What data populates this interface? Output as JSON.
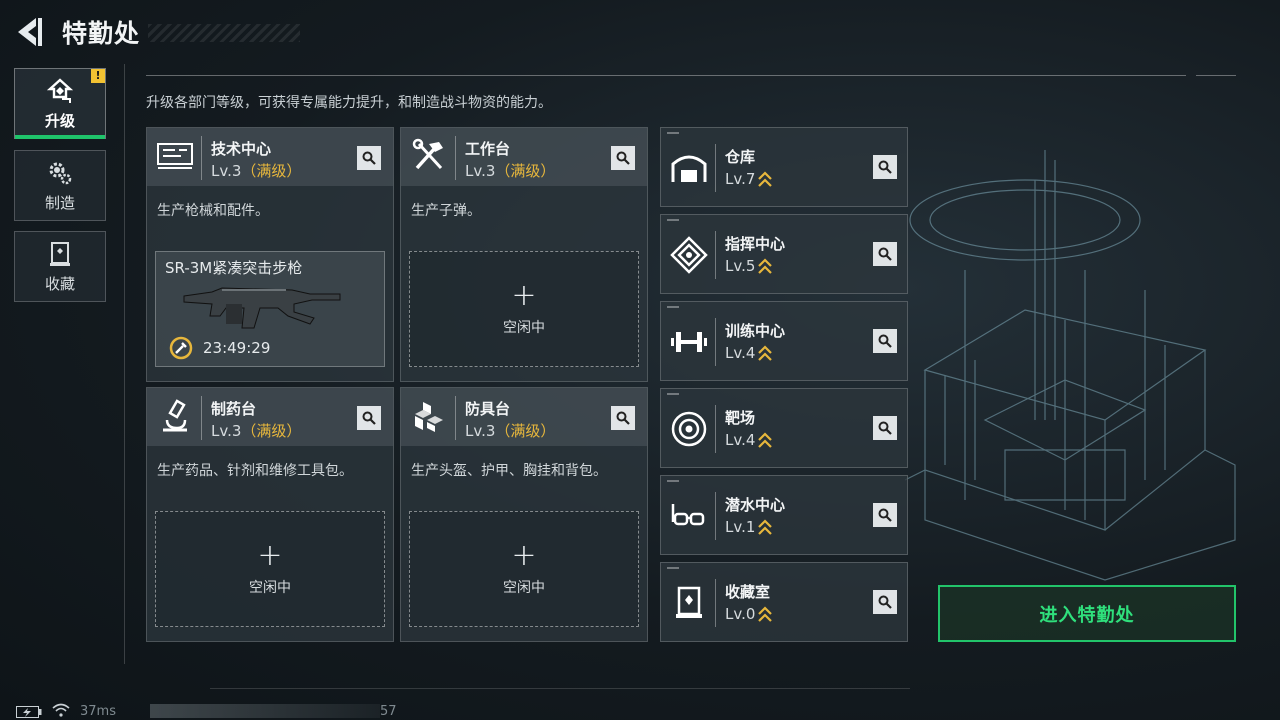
{
  "header": {
    "title": "特勤处"
  },
  "sidebar": {
    "tabs": [
      {
        "label": "升级",
        "active": true,
        "badge": "!"
      },
      {
        "label": "制造",
        "active": false
      },
      {
        "label": "收藏",
        "active": false
      }
    ]
  },
  "description": "升级各部门等级，可获得专属能力提升，和制造战斗物资的能力。",
  "departments": [
    {
      "name": "技术中心",
      "level": "Lv.3",
      "max_label": "（满级）",
      "desc": "生产枪械和配件。",
      "slot": {
        "state": "producing",
        "item": "SR-3M紧凑突击步枪",
        "timer": "23:49:29"
      }
    },
    {
      "name": "工作台",
      "level": "Lv.3",
      "max_label": "（满级）",
      "desc": "生产子弹。",
      "slot": {
        "state": "idle",
        "plus": "+",
        "label": "空闲中"
      }
    },
    {
      "name": "制药台",
      "level": "Lv.3",
      "max_label": "（满级）",
      "desc": "生产药品、针剂和维修工具包。",
      "slot": {
        "state": "idle",
        "plus": "+",
        "label": "空闲中"
      }
    },
    {
      "name": "防具台",
      "level": "Lv.3",
      "max_label": "（满级）",
      "desc": "生产头盔、护甲、胸挂和背包。",
      "slot": {
        "state": "idle",
        "plus": "+",
        "label": "空闲中"
      }
    }
  ],
  "facilities": [
    {
      "name": "仓库",
      "level": "Lv.7",
      "icon": "warehouse-icon"
    },
    {
      "name": "指挥中心",
      "level": "Lv.5",
      "icon": "chip-icon"
    },
    {
      "name": "训练中心",
      "level": "Lv.4",
      "icon": "dumbbell-icon"
    },
    {
      "name": "靶场",
      "level": "Lv.4",
      "icon": "target-icon"
    },
    {
      "name": "潜水中心",
      "level": "Lv.1",
      "icon": "diving-mask-icon"
    },
    {
      "name": "收藏室",
      "level": "Lv.0",
      "icon": "collection-icon"
    }
  ],
  "enter_button": "进入特勤处",
  "status": {
    "ping": "37ms",
    "fps": "57"
  },
  "colors": {
    "accent": "#22c46a",
    "max_level": "#e7b73c",
    "warning": "#f2c232"
  }
}
